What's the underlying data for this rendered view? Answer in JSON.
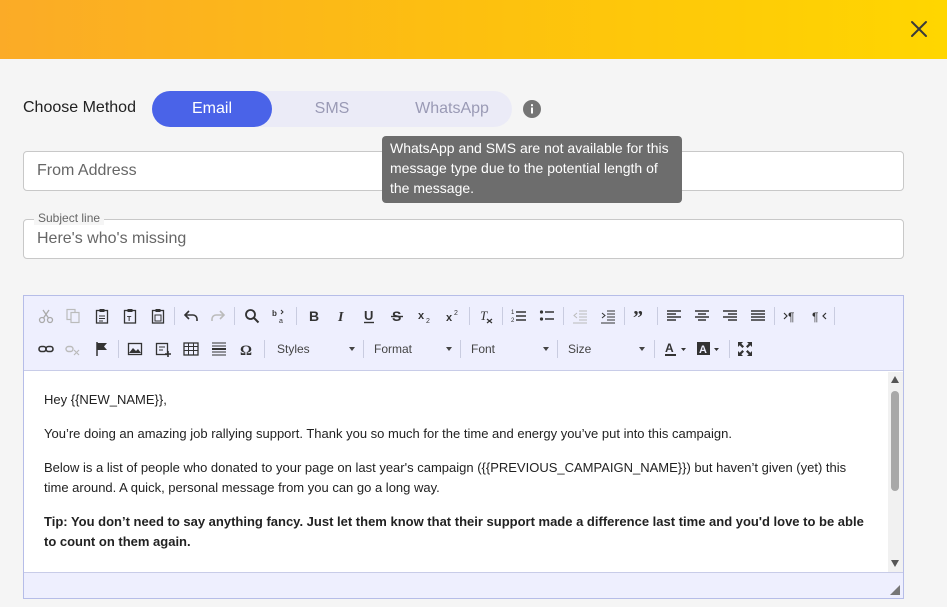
{
  "header": {
    "close_icon": "close-icon"
  },
  "method": {
    "label": "Choose Method",
    "options": [
      "Email",
      "SMS",
      "WhatsApp"
    ],
    "selected": "Email",
    "info_icon": "info-icon",
    "tooltip": "WhatsApp and SMS are not available for this message type due to the potential length of the message."
  },
  "from_field": {
    "placeholder": "From Address",
    "value": ""
  },
  "subject_field": {
    "label": "Subject line",
    "placeholder": "Here's who's missing",
    "value": ""
  },
  "toolbar": {
    "row1_icons": [
      "cut-icon",
      "copy-icon",
      "paste-icon",
      "paste-text-icon",
      "paste-word-icon",
      "undo-icon",
      "redo-icon",
      "find-icon",
      "replace-icon",
      "bold-icon",
      "italic-icon",
      "underline-icon",
      "strikethrough-icon",
      "subscript-icon",
      "superscript-icon",
      "remove-format-icon",
      "numbered-list-icon",
      "bulleted-list-icon",
      "decrease-indent-icon",
      "increase-indent-icon",
      "blockquote-icon",
      "align-left-icon",
      "align-center-icon",
      "align-right-icon",
      "justify-icon",
      "ltr-icon",
      "rtl-icon"
    ],
    "row2_icons": [
      "link-icon",
      "unlink-icon",
      "anchor-icon",
      "image-icon",
      "embed-icon",
      "table-icon",
      "horizontal-line-icon",
      "special-char-icon",
      "text-color-icon",
      "bg-color-icon",
      "maximize-icon"
    ],
    "styles_label": "Styles",
    "format_label": "Format",
    "font_label": "Font",
    "size_label": "Size"
  },
  "content": {
    "greeting": "Hey {{NEW_NAME}},",
    "para1": "You’re doing an amazing job rallying support. Thank you so much for the time and energy you’ve put into this campaign.",
    "para2": "Below is a list of people who donated to your page on last year's campaign ({{PREVIOUS_CAMPAIGN_NAME}}) but haven’t given (yet) this time around. A quick, personal message from you can go a long way.",
    "tip": "Tip: You don’t need to say anything fancy. Just let them know that their support made a difference last time and you'd love to be able to count on them again."
  },
  "colors": {
    "accent": "#4a63e8",
    "header_start": "#fbab27",
    "header_end": "#ffd600",
    "tooltip_bg": "#6d6d6d"
  }
}
